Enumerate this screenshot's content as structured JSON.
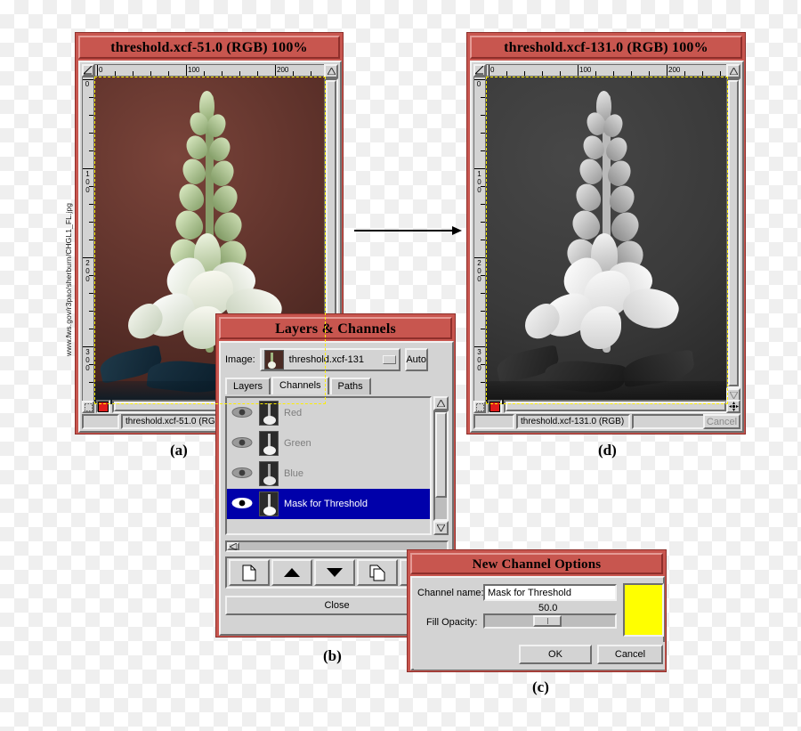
{
  "figure": {
    "labels": {
      "a": "(a)",
      "b": "(b)",
      "c": "(c)",
      "d": "(d)"
    },
    "photo_credit": "www.fws.gov/r3pao/sherburn/CHGL1_FL.jpg"
  },
  "colors": {
    "titlebar": "#c8564f",
    "panel": "#d3d3d3",
    "selection": "#0000aa",
    "fill_swatch": "#ffff00",
    "canvas_marching_ants": "#ffee00",
    "status_red_indicator": "#e01b1b"
  },
  "window_a": {
    "title": "threshold.xcf-51.0 (RGB) 100%",
    "ruler_h_ticks": [
      "0",
      "100",
      "200"
    ],
    "ruler_v_ticks": [
      "0",
      "100",
      "200",
      "300"
    ],
    "status_text": "threshold.xcf-51.0 (RG",
    "cancel_label": ""
  },
  "window_d": {
    "title": "threshold.xcf-131.0 (RGB) 100%",
    "ruler_h_ticks": [
      "0",
      "100",
      "200"
    ],
    "ruler_v_ticks": [
      "0",
      "100",
      "200",
      "300"
    ],
    "status_text": "threshold.xcf-131.0 (RGB)",
    "cancel_label": "Cancel"
  },
  "layers_channels": {
    "title": "Layers & Channels",
    "image_label": "Image:",
    "image_value": "threshold.xcf-131",
    "auto_label": "Auto",
    "tabs": [
      {
        "label": "Layers",
        "active": false
      },
      {
        "label": "Channels",
        "active": true
      },
      {
        "label": "Paths",
        "active": false
      }
    ],
    "channels": [
      {
        "label": "Red",
        "visible": true,
        "selected": false
      },
      {
        "label": "Green",
        "visible": true,
        "selected": false
      },
      {
        "label": "Blue",
        "visible": true,
        "selected": false
      },
      {
        "label": "Mask for Threshold",
        "visible": true,
        "selected": true
      }
    ],
    "toolbar_icons": [
      "new-channel-icon",
      "raise-channel-icon",
      "lower-channel-icon",
      "duplicate-channel-icon",
      "channel-to-selection-icon"
    ],
    "close_label": "Close"
  },
  "new_channel_options": {
    "title": "New Channel Options",
    "channel_name_label": "Channel name:",
    "channel_name_value": "Mask for Threshold",
    "fill_opacity_label": "Fill Opacity:",
    "fill_opacity_value": "50.0",
    "ok_label": "OK",
    "cancel_label": "Cancel"
  }
}
